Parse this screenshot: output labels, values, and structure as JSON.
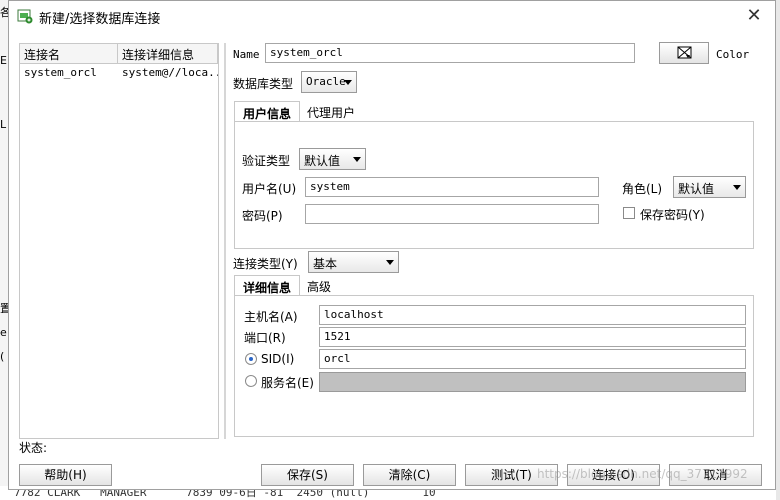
{
  "background": {
    "left_fragments": [
      "各",
      "E",
      "L",
      "置",
      "e",
      "("
    ],
    "bottom_row": "7782 CLARK   MANAGER      7839 09-6日 -81  2450 (null)        10"
  },
  "dialog": {
    "title": "新建/选择数据库连接",
    "close_glyph": "✕"
  },
  "connections": {
    "headers": [
      "连接名",
      "连接详细信息"
    ],
    "rows": [
      {
        "name": "system_orcl",
        "details": "system@//loca..."
      }
    ]
  },
  "form": {
    "name_label": "Name",
    "name_value": "system_orcl",
    "color_label": "Color",
    "db_type_label": "数据库类型",
    "db_type_value": "Oracle",
    "tabs_user": [
      "用户信息",
      "代理用户"
    ],
    "auth_type_label": "验证类型",
    "auth_type_value": "默认值",
    "username_label": "用户名(U)",
    "username_value": "system",
    "role_label": "角色(L)",
    "role_value": "默认值",
    "password_label": "密码(P)",
    "password_value": "",
    "save_password_label": "保存密码(Y)",
    "conn_type_label": "连接类型(Y)",
    "conn_type_value": "基本",
    "tabs_detail": [
      "详细信息",
      "高级"
    ],
    "host_label": "主机名(A)",
    "host_value": "localhost",
    "port_label": "端口(R)",
    "port_value": "1521",
    "sid_label": "SID(I)",
    "sid_value": "orcl",
    "service_label": "服务名(E)",
    "service_value": ""
  },
  "status_label": "状态:",
  "buttons": {
    "help": "帮助(H)",
    "save": "保存(S)",
    "clear": "清除(C)",
    "test": "测试(T)",
    "connect": "连接(O)",
    "cancel": "取消"
  },
  "watermark": "https://blog.csdn.net/qq_37711992"
}
